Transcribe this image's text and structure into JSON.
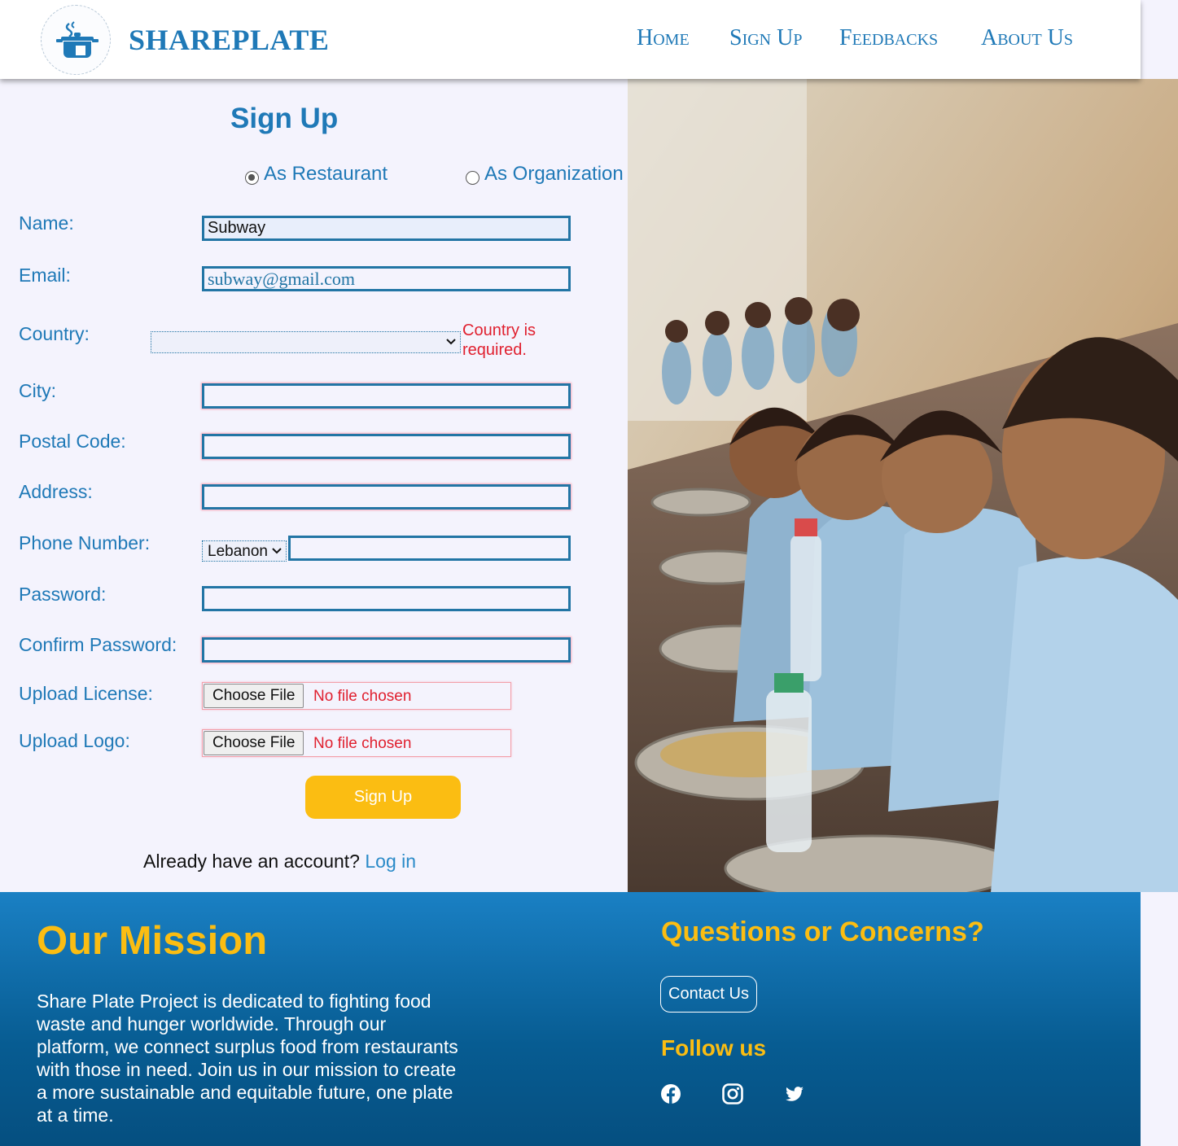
{
  "header": {
    "brand": "SHAREPLATE",
    "nav": [
      "Home",
      "Sign Up",
      "Feedbacks",
      "About Us"
    ]
  },
  "form": {
    "title": "Sign Up",
    "account_type": {
      "options": [
        "As Restaurant",
        "As Organization"
      ],
      "selected": "As Restaurant"
    },
    "labels": {
      "name": "Name:",
      "email": "Email:",
      "country": "Country:",
      "city": "City:",
      "postal": "Postal Code:",
      "address": "Address:",
      "phone": "Phone Number:",
      "password": "Password:",
      "confirm": "Confirm Password:",
      "license": "Upload License:",
      "logo": "Upload Logo:"
    },
    "values": {
      "name": "Subway",
      "email": "subway@gmail.com",
      "country": "",
      "phone_country": "Lebanon",
      "city": "",
      "postal": "",
      "address": "",
      "phone": "",
      "password": "",
      "confirm": ""
    },
    "country_error": "Country is required.",
    "file_button": "Choose File",
    "no_file": "No file chosen",
    "submit": "Sign Up",
    "account_prompt": "Already have an account?",
    "login_link": "Log in"
  },
  "footer": {
    "mission_title": "Our Mission",
    "mission_text": "Share Plate Project is dedicated to fighting food waste and hunger worldwide. Through our platform, we connect surplus food from restaurants with those in need. Join us in our mission to create a more sustainable and equitable future, one plate at a time.",
    "questions_title": "Questions or Concerns?",
    "contact": "Contact Us",
    "follow": "Follow us",
    "social": [
      "facebook-icon",
      "instagram-icon",
      "twitter-icon"
    ]
  },
  "colors": {
    "brand_blue": "#1f79b7",
    "accent_yellow": "#fbbd12",
    "error_red": "#e0202f"
  }
}
